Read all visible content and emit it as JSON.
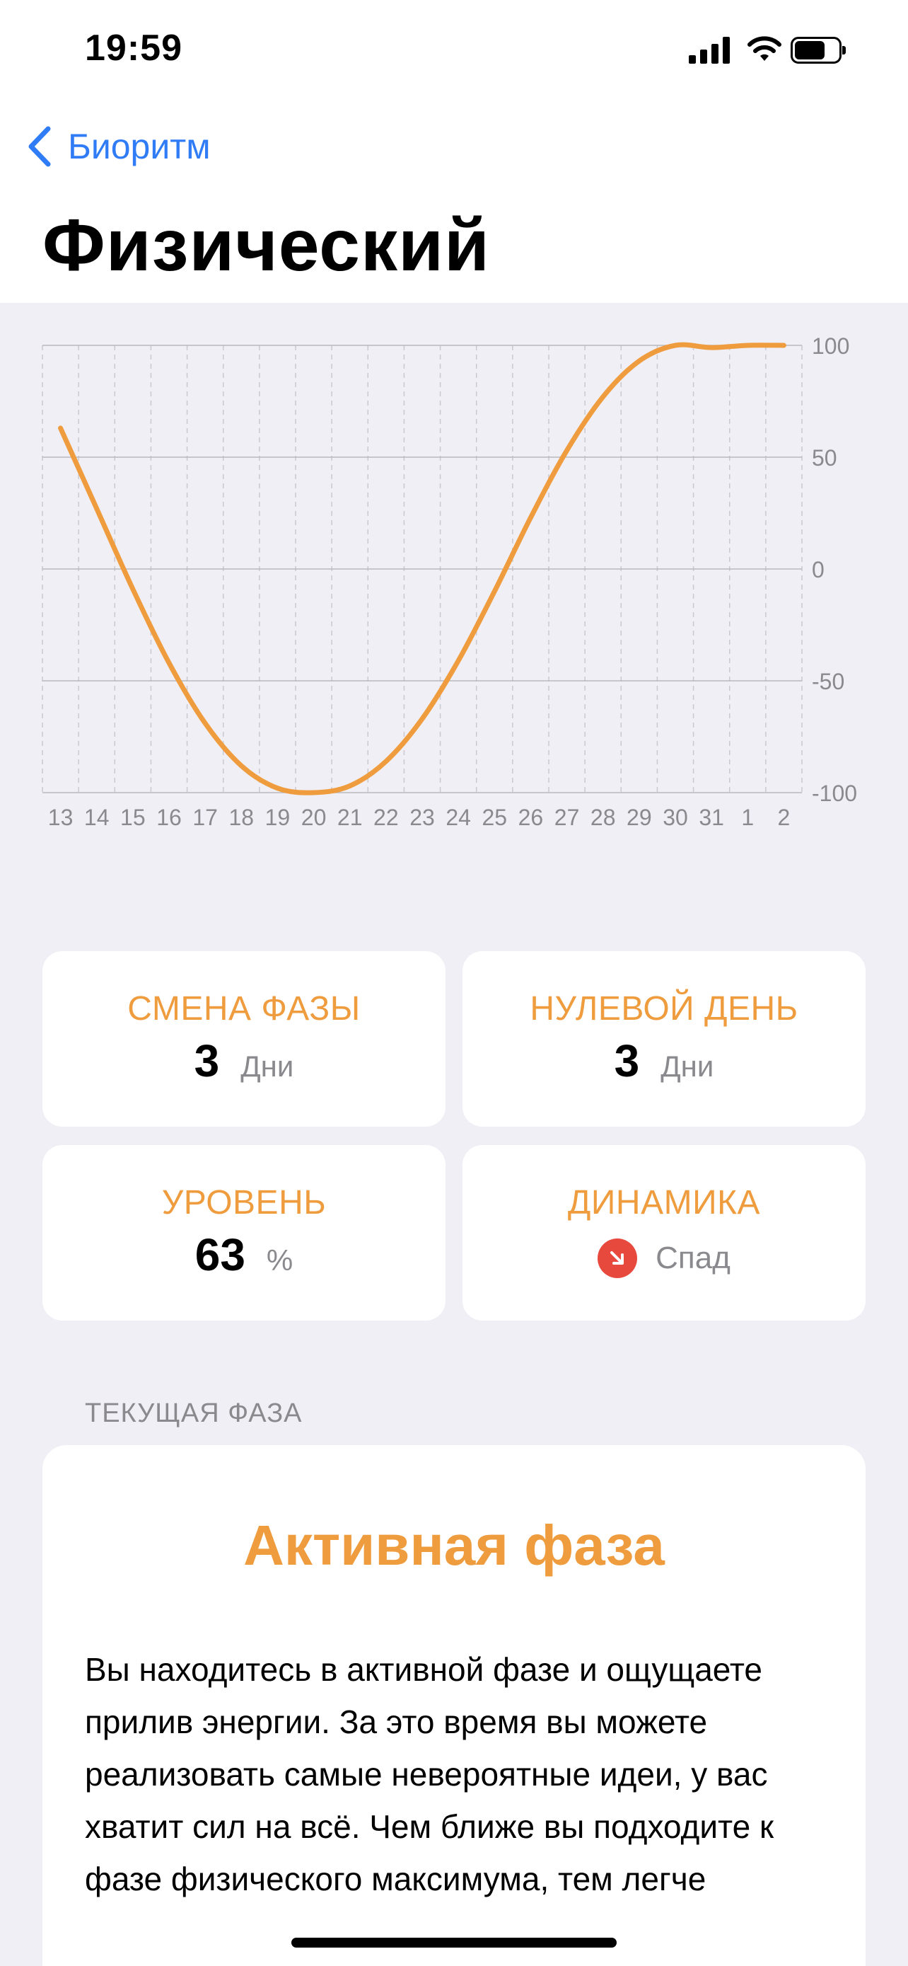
{
  "status_bar": {
    "time": "19:59"
  },
  "nav": {
    "back_label": "Биоритм",
    "title": "Физический"
  },
  "chart_data": {
    "type": "line",
    "x": [
      "13",
      "14",
      "15",
      "16",
      "17",
      "18",
      "19",
      "20",
      "21",
      "22",
      "23",
      "24",
      "25",
      "26",
      "27",
      "28",
      "29",
      "30",
      "31",
      "1",
      "2"
    ],
    "series": [
      {
        "values": [
          63,
          27,
          -9,
          -42,
          -69,
          -88,
          -98,
          -100,
          -97,
          -86,
          -67,
          -41,
          -10,
          23,
          53,
          77,
          93,
          100,
          99,
          100,
          100
        ]
      }
    ],
    "y_ticks": [
      100,
      50,
      0,
      -50,
      -100
    ],
    "ylim": [
      -100,
      100
    ],
    "color": "#ef9c3e",
    "grid": true
  },
  "stats": {
    "phase_change": {
      "label": "СМЕНА ФАЗЫ",
      "value": "3",
      "unit": "Дни"
    },
    "zero_day": {
      "label": "НУЛЕВОЙ ДЕНЬ",
      "value": "3",
      "unit": "Дни"
    },
    "level": {
      "label": "УРОВЕНЬ",
      "value": "63",
      "unit": "%"
    },
    "dynamics": {
      "label": "ДИНАМИКА",
      "value": "Спад",
      "icon": "arrow-down-right-icon"
    }
  },
  "current_phase": {
    "section_label": "ТЕКУЩАЯ ФАЗА",
    "title": "Активная фаза",
    "text": "Вы находитесь в активной фазе и ощущаете прилив энергии. За это время вы можете реализовать самые невероятные идеи, у вас хватит сил на всё. Чем ближе вы подходите к фазе физического максимума, тем легче"
  },
  "colors": {
    "accent": "#ef9c3e",
    "link": "#2f7cf6",
    "decline": "#e8493d"
  }
}
